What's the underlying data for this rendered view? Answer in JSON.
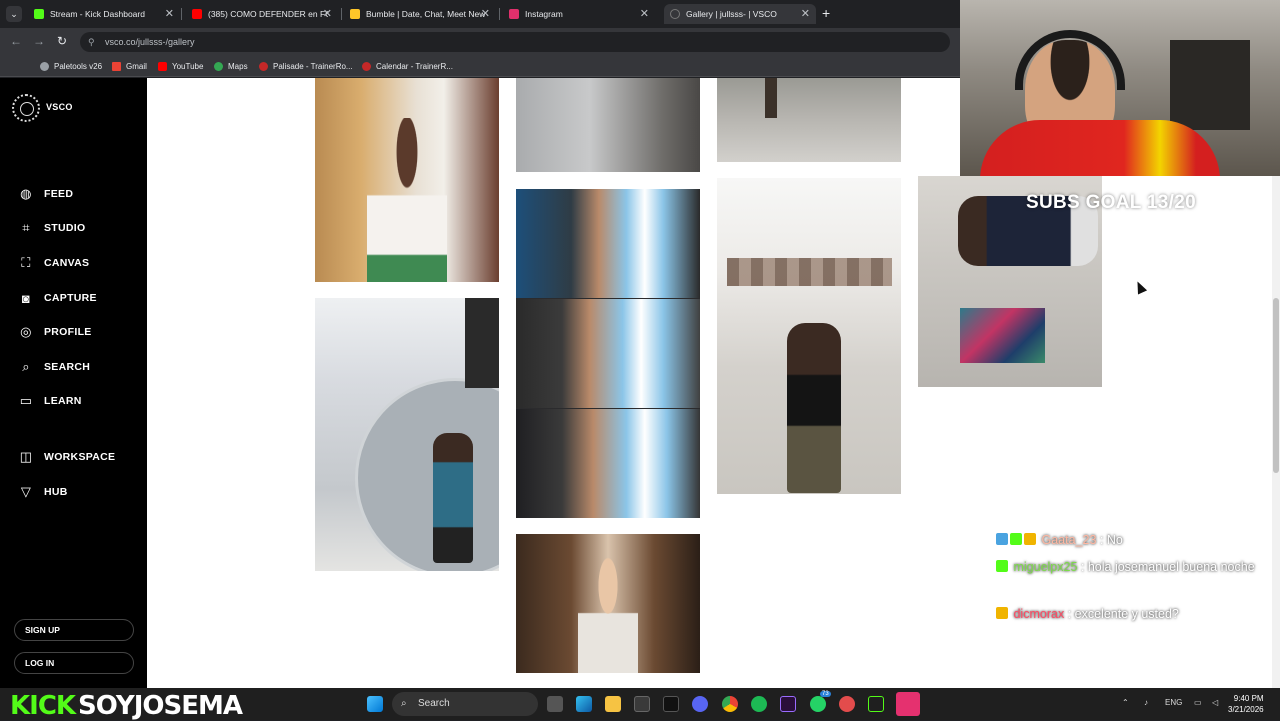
{
  "browser": {
    "tabs": [
      {
        "title": "Stream - Kick Dashboard",
        "favicon_color": "#53fc18"
      },
      {
        "title": "(385) COMO DEFENDER en FC",
        "favicon_color": "#ff0000"
      },
      {
        "title": "Bumble | Date, Chat, Meet New",
        "favicon_color": "#ffc629"
      },
      {
        "title": "Instagram",
        "favicon_color": "#e1306c"
      },
      {
        "title": "Gallery | jullsss- | VSCO",
        "favicon_color": "#35363a"
      }
    ],
    "close_glyph": "✕",
    "new_tab_glyph": "+",
    "url": "vsco.co/jullsss-/gallery",
    "bookmarks": [
      {
        "label": "Paletools v26",
        "color": "#e8eaed"
      },
      {
        "label": "Gmail",
        "color": "#ea4335"
      },
      {
        "label": "YouTube",
        "color": "#ff0000"
      },
      {
        "label": "Maps",
        "color": "#34a853"
      },
      {
        "label": "Palisade - TrainerRo...",
        "color": "#c62828"
      },
      {
        "label": "Calendar - TrainerR...",
        "color": "#c62828"
      }
    ]
  },
  "vsco": {
    "logo_text": "VSCO",
    "nav": [
      {
        "label": "FEED",
        "icon": "globe-icon",
        "glyph": "◍"
      },
      {
        "label": "STUDIO",
        "icon": "crop-icon",
        "glyph": "⌗"
      },
      {
        "label": "CANVAS",
        "icon": "canvas-icon",
        "glyph": "⛶"
      },
      {
        "label": "CAPTURE",
        "icon": "camera-icon",
        "glyph": "◙"
      },
      {
        "label": "PROFILE",
        "icon": "profile-icon",
        "glyph": "◎"
      },
      {
        "label": "SEARCH",
        "icon": "search-icon",
        "glyph": "⌕"
      },
      {
        "label": "LEARN",
        "icon": "book-icon",
        "glyph": "▭"
      }
    ],
    "nav2": [
      {
        "label": "WORKSPACE",
        "icon": "workspace-icon",
        "glyph": "◫"
      },
      {
        "label": "HUB",
        "icon": "hub-icon",
        "glyph": "▽"
      }
    ],
    "sign_up": "SIGN UP",
    "log_in": "LOG IN"
  },
  "stream_overlay": {
    "subs_goal": "SUBS GOAL 13/20",
    "chat": [
      {
        "user": "Gaata_23",
        "message": ": No",
        "user_color": "#ffb7a1"
      },
      {
        "user": "miguelpx25",
        "message": ": hola josemanuel buena noche",
        "user_color": "#7ddc4a"
      },
      {
        "user": "dicmorax",
        "message": ": excelente y usted?",
        "user_color": "#ff4a63"
      }
    ],
    "platform": "KICK",
    "streamer": "SOYJOSEMA"
  },
  "taskbar": {
    "search_placeholder": "Search",
    "language": "ENG",
    "time": "9:40 PM",
    "date": "3/21/2026",
    "whatsapp_badge": "73"
  }
}
